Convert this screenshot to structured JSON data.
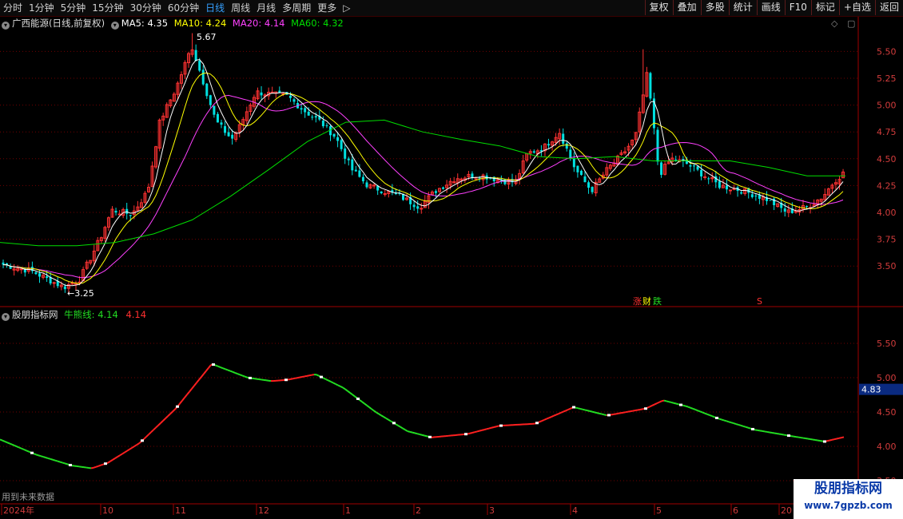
{
  "toolbar": {
    "periods": [
      "分时",
      "1分钟",
      "5分钟",
      "15分钟",
      "30分钟",
      "60分钟",
      "日线",
      "周线",
      "月线",
      "多周期",
      "更多"
    ],
    "active_period": "日线",
    "more_arrow": "▷",
    "buttons": [
      "复权",
      "叠加",
      "多股",
      "统计",
      "画线",
      "F10",
      "标记",
      "+自选",
      "返回"
    ]
  },
  "main_header": {
    "stock": "广西能源(日线,前复权)",
    "ma5_label": "MA5:",
    "ma5_value": "4.35",
    "ma10_label": "MA10:",
    "ma10_value": "4.24",
    "ma20_label": "MA20:",
    "ma20_value": "4.14",
    "ma60_label": "MA60:",
    "ma60_value": "4.32"
  },
  "indicator_header": {
    "name": "股朋指标网",
    "line_label": "牛熊线:",
    "value_green": "4.14",
    "value_red": "4.14"
  },
  "colors": {
    "up": "#ff3232",
    "down": "#00e0e0",
    "ma5": "#ffffff",
    "ma10": "#ffff00",
    "ma20": "#ff40ff",
    "ma60": "#00dd00",
    "bull": "#ff2020",
    "bear": "#22dd22",
    "grid": "#700000",
    "axis_label": "#d23c3c"
  },
  "annotations": {
    "high_label": "5.67",
    "low_label": "3.25",
    "event_zhang": "涨",
    "event_caibao": "财",
    "event_die": "跌",
    "event_s": "S"
  },
  "axis": {
    "price_ticks": [
      "5.50",
      "5.25",
      "5.00",
      "4.75",
      "4.50",
      "4.25",
      "4.00",
      "3.75",
      "3.50"
    ],
    "indicator_ticks": [
      "5.50",
      "5.00",
      "4.50",
      "4.00",
      "3.50"
    ],
    "indicator_marker": "4.83",
    "x_labels": [
      "2024年",
      "10",
      "11",
      "12",
      "1",
      "2",
      "3",
      "4",
      "5",
      "6",
      "20"
    ]
  },
  "chart_data": {
    "type": "candlestick",
    "price_range": [
      3.25,
      5.67
    ],
    "ma_latest": {
      "MA5": 4.35,
      "MA10": 4.24,
      "MA20": 4.14,
      "MA60": 4.32
    },
    "indicator": {
      "name": "牛熊线",
      "latest": 4.14,
      "marker": 4.83
    },
    "ma60_trace": [
      3.72,
      3.69,
      3.69,
      3.72,
      3.8,
      3.93,
      4.15,
      4.4,
      4.66,
      4.84,
      4.86,
      4.75,
      4.68,
      4.62,
      4.52,
      4.5,
      4.52,
      4.48,
      4.48,
      4.48,
      4.42,
      4.34,
      4.34
    ]
  },
  "footer": {
    "note": "用到未来数据"
  },
  "watermark": {
    "title": "股朋指标网",
    "url": "www.7gpzb.com"
  }
}
